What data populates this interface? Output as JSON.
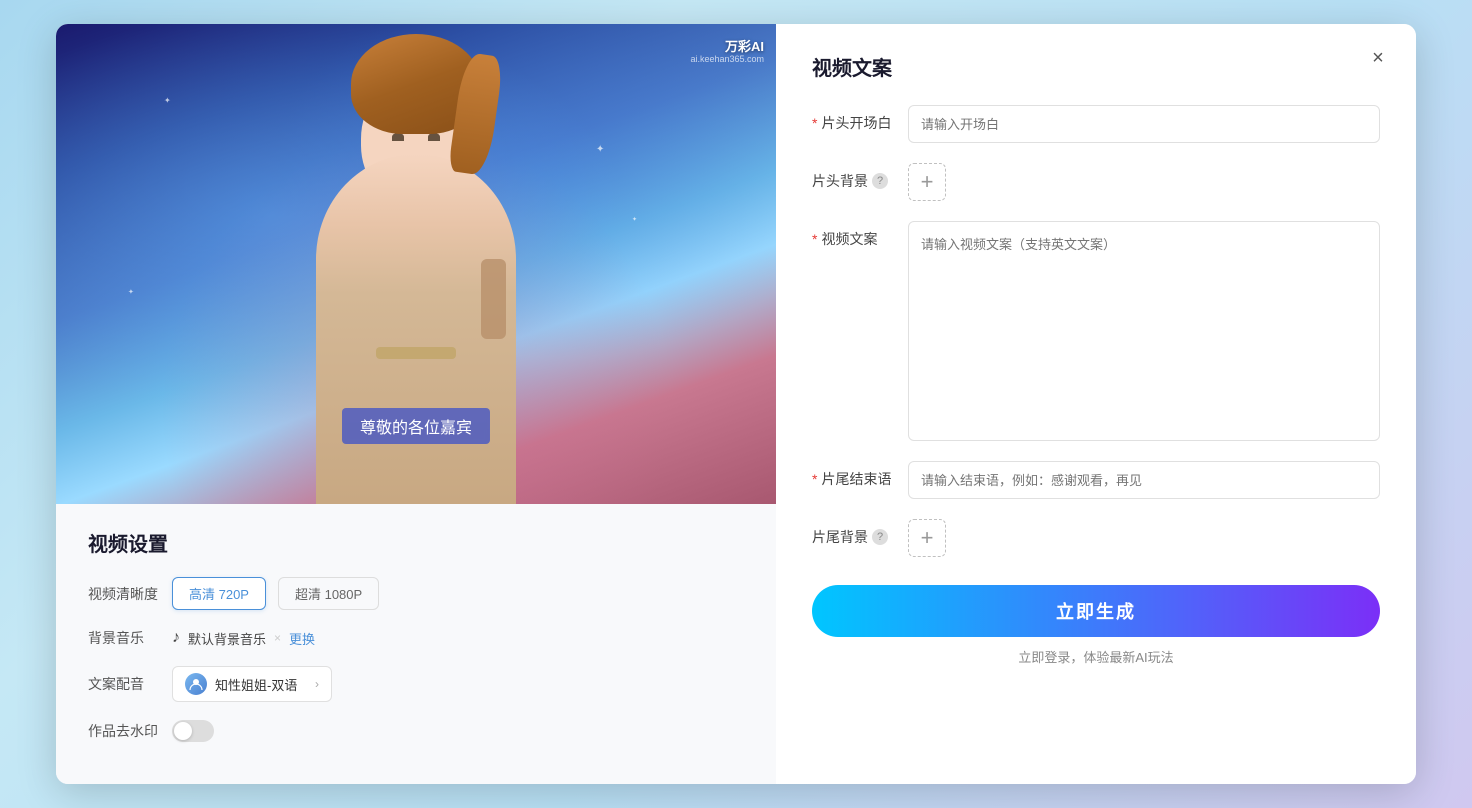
{
  "modal": {
    "close_btn": "×",
    "left": {
      "watermark_brand": "万彩AI",
      "watermark_site": "ai.keehan365.com",
      "subtitle": "尊敬的各位嘉宾",
      "settings_title": "视频设置",
      "quality_label": "视频清晰度",
      "quality_options": [
        {
          "label": "高清 720P",
          "active": true
        },
        {
          "label": "超清 1080P",
          "active": false
        }
      ],
      "music_label": "背景音乐",
      "music_name": "默认背景音乐",
      "music_replace": "更换",
      "voice_label": "文案配音",
      "voice_name": "知性姐姐-双语",
      "watermark_label": "作品去水印"
    },
    "right": {
      "panel_title": "视频文案",
      "opening_label": "片头开场白",
      "opening_required": "*",
      "opening_placeholder": "请输入开场白",
      "bg_label": "片头背景",
      "bg_help": "?",
      "content_label": "视频文案",
      "content_required": "*",
      "content_placeholder": "请输入视频文案（支持英文文案）",
      "ending_label": "片尾结束语",
      "ending_required": "*",
      "ending_placeholder": "请输入结束语，例如：感谢观看，再见",
      "ending_bg_label": "片尾背景",
      "ending_bg_help": "?",
      "submit_label": "立即生成",
      "login_hint": "立即登录，体验最新AI玩法"
    }
  }
}
